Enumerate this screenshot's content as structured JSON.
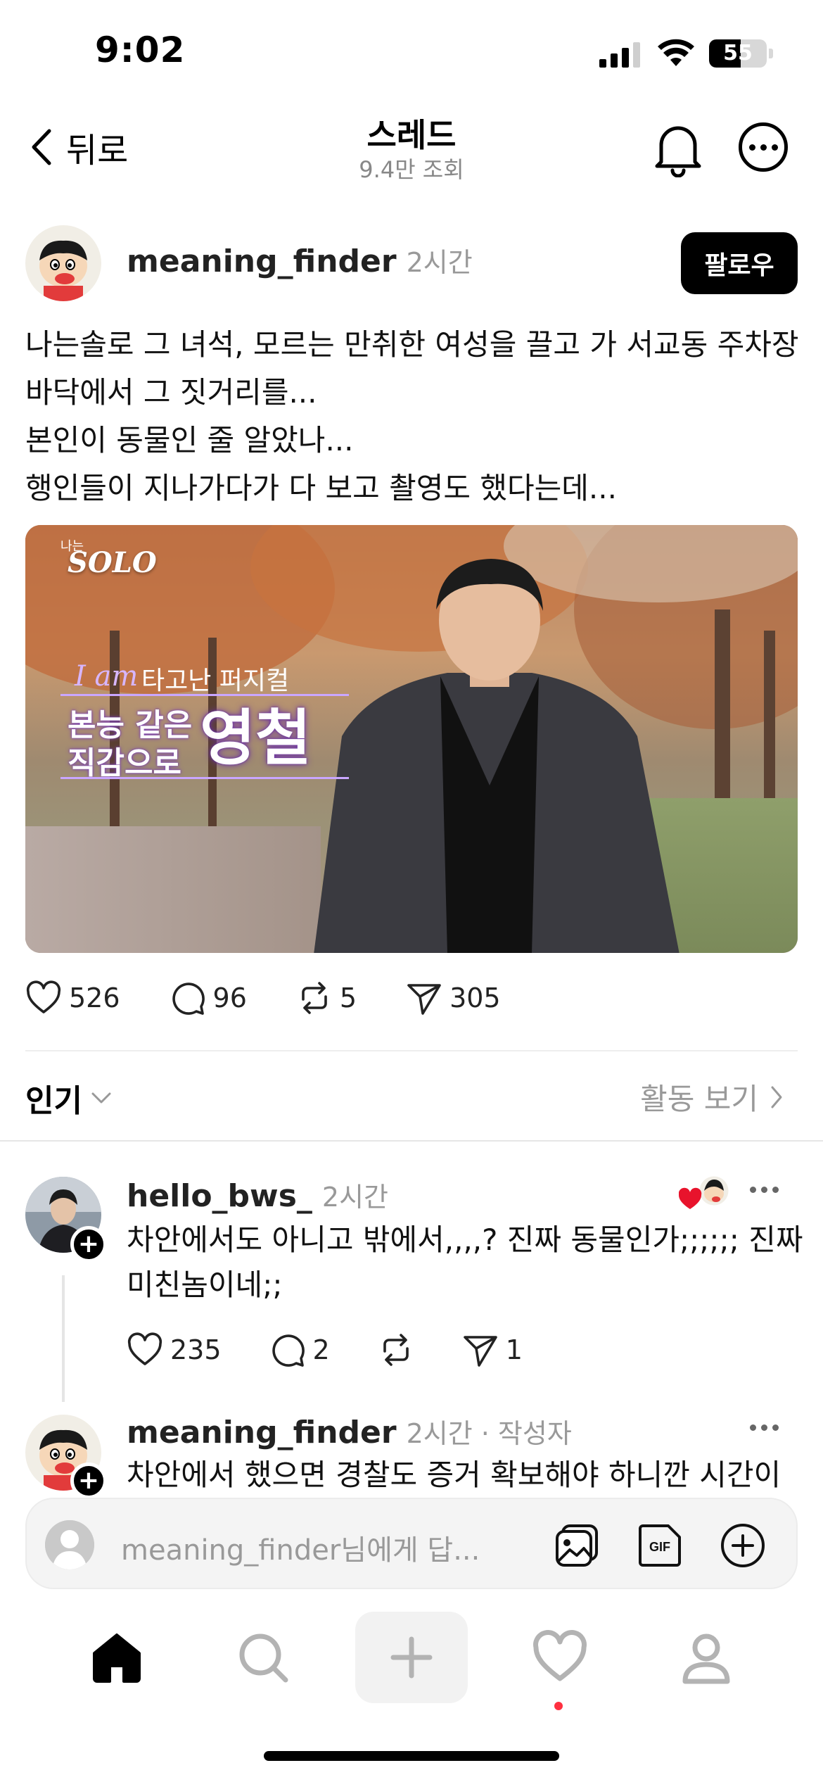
{
  "status": {
    "time": "9:02",
    "battery": "55",
    "battery_level": 0.55
  },
  "nav": {
    "back_label": "뒤로",
    "title": "스레드",
    "views": "9.4만 조회"
  },
  "post": {
    "username": "meaning_finder",
    "time": "2시간",
    "follow_label": "팔로우",
    "text_lines": [
      "나는솔로 그 녀석, 모르는 만취한 여성을 끌고 가 서교동 주차장",
      "바닥에서 그 짓거리를...",
      "본인이 동물인 줄 알았나...",
      "행인들이 지나가다가 다 보고 촬영도 했다는데..."
    ],
    "image": {
      "logo_small": "나는",
      "logo": "SOLO",
      "caption_script": "I am",
      "caption_hand": "타고난 퍼지컬",
      "caption_line1": "본능 같은",
      "caption_line2": "직감으로",
      "caption_name": "영철"
    },
    "likes": "526",
    "comments": "96",
    "reposts": "5",
    "shares": "305"
  },
  "sort": {
    "label": "인기",
    "activity_label": "활동 보기"
  },
  "replies": [
    {
      "username": "hello_bws_",
      "time": "2시간",
      "lines": [
        "차안에서도 아니고 밖에서,,,,? 진짜 동물인가;;;;;; 진짜",
        "미친놈이네;;"
      ],
      "likes": "235",
      "comments": "2",
      "shares": "1"
    },
    {
      "username": "meaning_finder",
      "time": "2시간 · 작성자",
      "lines": [
        "차안에서 했으면 경찰도 증거 확보해야 하니깐 시간이"
      ]
    }
  ],
  "reply_bar": {
    "placeholder": "meaning_finder님에게 답..."
  },
  "icons": {
    "back": "chevron-left-icon",
    "bell": "bell-icon",
    "more": "more-icon",
    "heart": "heart-icon",
    "comment": "comment-icon",
    "repost": "repost-icon",
    "share": "send-icon",
    "gallery": "gallery-icon",
    "gif": "gif-icon",
    "add": "add-circle-icon",
    "home": "home-icon",
    "search": "search-icon",
    "create": "plus-icon",
    "activity": "heart-icon",
    "profile": "profile-icon"
  },
  "colors": {
    "notification_dot": "#ff3040",
    "liked_heart": "#e8132c"
  }
}
